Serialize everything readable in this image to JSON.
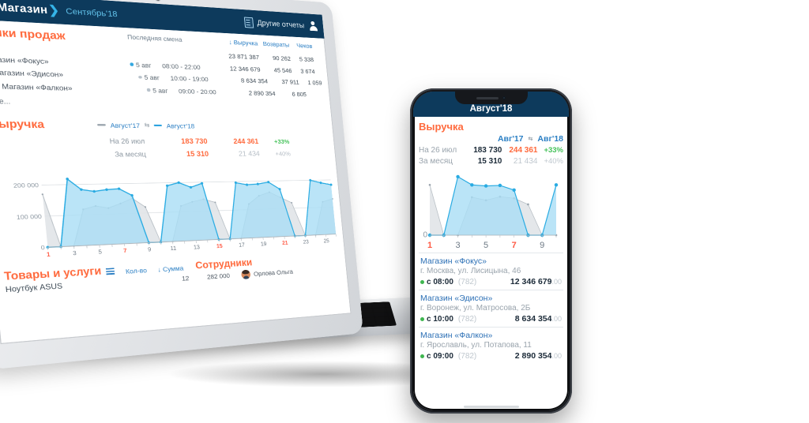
{
  "laptop": {
    "navbar": {
      "menu_icon": "hamburger-icon",
      "brand": "Магазин",
      "brand_mark": "❯",
      "period": "Сентябрь'18",
      "reports_icon": "document-icon",
      "reports_label": "Другие отчеты",
      "account_icon": "user-icon"
    },
    "points": {
      "title": "Точки продаж",
      "shift_header": "Последняя смена",
      "columns": [
        "↓ Выручка",
        "Возвраты",
        "Чеков"
      ],
      "totals": [
        "23 871 387",
        "90 262",
        "5 338"
      ],
      "rows": [
        {
          "name": "Магазин «Фокус»",
          "date": "5 авг",
          "time": "08:00 - 22:00",
          "revenue": "12 346 679",
          "returns": "45 546",
          "checks": "3 674"
        },
        {
          "name": "Магазин «Эдисон»",
          "date": "5 авг",
          "time": "10:00 - 19:00",
          "revenue": "8 634 354",
          "returns": "37 911",
          "checks": "1 059"
        },
        {
          "name": "Магазин «Фалкон»",
          "date": "5 авг",
          "time": "09:00 - 20:00",
          "revenue": "2 890 354",
          "returns": "6 805",
          "checks": ""
        }
      ],
      "more": "Еще..."
    },
    "revenue": {
      "title": "Выручка",
      "legend_prev": "Август'17",
      "legend_cur": "Август'18",
      "swap_icon": "swap-icon",
      "rows": [
        {
          "label": "На 26 июл",
          "prev": "183 730",
          "cur": "244 361",
          "delta": "+33%"
        },
        {
          "label": "За месяц",
          "prev": "15 310",
          "cur": "21 434",
          "delta": "+40%"
        }
      ]
    },
    "goods": {
      "title": "Товары и услуги",
      "list_icon": "list-icon",
      "col_qty": "Кол-во",
      "col_sum": "↓ Сумма",
      "employees_title": "Сотрудники",
      "row": {
        "name": "Ноутбук ASUS",
        "qty": "12",
        "sum": "282 000"
      },
      "employee": {
        "name": "Орлова Ольга",
        "avatar": "avatar-photo"
      }
    }
  },
  "phone": {
    "navbar": {
      "title": "Август'18"
    },
    "revenue": {
      "title": "Выручка",
      "legend_prev": "Авг'17",
      "legend_cur": "Авг'18",
      "swap_icon": "swap-icon",
      "rows": [
        {
          "label": "На 26 июл",
          "prev": "183 730",
          "cur": "244 361",
          "delta": "+33%"
        },
        {
          "label": "За месяц",
          "prev": "15 310",
          "cur": "21 434",
          "delta": "+40%"
        }
      ]
    },
    "stores": [
      {
        "name": "Магазин «Фокус»",
        "address": "г. Москва, ул. Лисицына, 46",
        "open": "с 08:00",
        "count": "(782)",
        "sum": "12 346 679",
        "cents": ".00"
      },
      {
        "name": "Магазин «Эдисон»",
        "address": "г. Воронеж, ул. Матросова, 2Б",
        "open": "с 10:00",
        "count": "(782)",
        "sum": "8 634 354",
        "cents": ".00"
      },
      {
        "name": "Магазин «Фалкон»",
        "address": "г. Ярославль, ул. Потапова, 11",
        "open": "с 09:00",
        "count": "(782)",
        "sum": "2 890 354",
        "cents": ".00"
      }
    ]
  },
  "colors": {
    "navy": "#0d3a5c",
    "accent_orange": "#ff6a3d",
    "accent_blue": "#2b7fc4",
    "series_cur": "#29abe2",
    "series_cur_fill": "#a9ddf5",
    "series_prev": "#b9c0c6",
    "green": "#45c25a"
  },
  "chart_data": [
    {
      "type": "area",
      "id": "laptop-revenue-chart",
      "title": "Выручка",
      "xlabel": "",
      "ylabel": "",
      "ylim": [
        0,
        240000
      ],
      "yticks": [
        0,
        100000,
        200000
      ],
      "ytick_labels": [
        "0",
        "100 000",
        "200 000"
      ],
      "grid": true,
      "legend": [
        "Август'17",
        "Август'18"
      ],
      "legend_position": "top",
      "x": [
        1,
        2,
        3,
        4,
        5,
        6,
        7,
        8,
        9,
        10,
        11,
        12,
        13,
        14,
        15,
        16,
        17,
        18,
        19,
        20,
        21,
        22,
        23,
        24,
        25,
        26
      ],
      "xtick_labels": [
        "1",
        "3",
        "5",
        "7",
        "9",
        "11",
        "13",
        "15",
        "17",
        "19",
        "21",
        "23",
        "25"
      ],
      "weekend_ticks": [
        "1",
        "7",
        "15",
        "21"
      ],
      "series": [
        {
          "name": "Август'18",
          "color": "#29abe2",
          "values": [
            0,
            0,
            218000,
            183000,
            176000,
            181000,
            183000,
            160000,
            0,
            0,
            190000,
            200000,
            183000,
            196000,
            0,
            0,
            196000,
            188000,
            190000,
            196000,
            170000,
            0,
            0,
            200000,
            190000,
            182000
          ]
        },
        {
          "name": "Август'17",
          "color": "#b9c0c6",
          "values": [
            170000,
            0,
            0,
            118000,
            128000,
            120000,
            134000,
            150000,
            120000,
            0,
            0,
            120000,
            133000,
            141000,
            129000,
            0,
            0,
            120000,
            148000,
            160000,
            140000,
            120000,
            0,
            0,
            120000,
            130000
          ]
        }
      ]
    },
    {
      "type": "area",
      "id": "phone-revenue-chart",
      "title": "Выручка",
      "ylim": [
        0,
        240000
      ],
      "yticks": [
        0
      ],
      "ytick_labels": [
        "0"
      ],
      "grid": false,
      "legend": [
        "Авг'17",
        "Авг'18"
      ],
      "x": [
        1,
        2,
        3,
        4,
        5,
        6,
        7,
        8,
        9,
        10
      ],
      "xtick_labels": [
        "1",
        "3",
        "5",
        "7",
        "9"
      ],
      "weekend_ticks": [
        "1",
        "7"
      ],
      "series": [
        {
          "name": "Авг'18",
          "color": "#29abe2",
          "values": [
            0,
            0,
            228000,
            196000,
            192000,
            194000,
            176000,
            0,
            0,
            196000
          ]
        },
        {
          "name": "Авг'17",
          "color": "#b9c0c6",
          "values": [
            196000,
            0,
            0,
            148000,
            136000,
            150000,
            144000,
            120000,
            0,
            0
          ]
        }
      ]
    }
  ]
}
